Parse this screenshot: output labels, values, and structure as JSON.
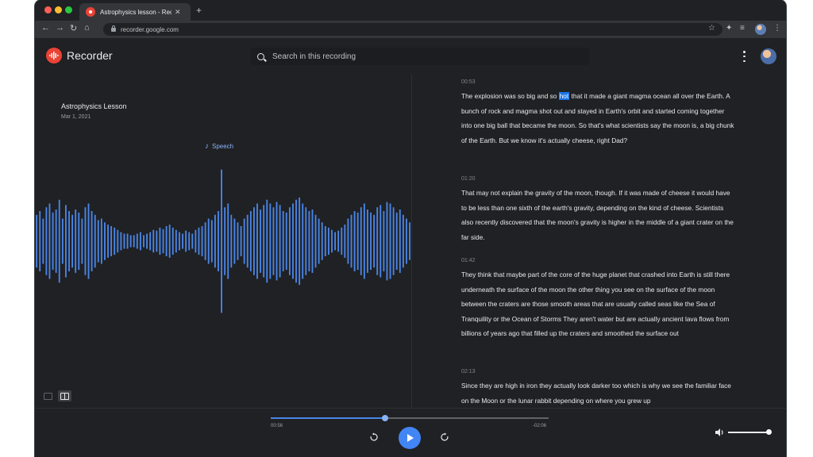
{
  "browser": {
    "tab_title": "Astrophysics lesson - Recorder",
    "new_tab": "+",
    "url": "recorder.google.com"
  },
  "app": {
    "title": "Recorder",
    "search_placeholder": "Search in this recording"
  },
  "recording": {
    "title": "Astrophysics Lesson",
    "date": "Mar 1, 2021",
    "label": "Speech"
  },
  "transcript": [
    {
      "time": "00:53",
      "pre": "The explosion was so big and so ",
      "highlight": "hot",
      "post": " that it made a giant magma ocean all over the Earth. A bunch of rock and magma shot out and stayed in Earth's orbit and started coming together into one big ball that became the moon. So that's what scientists say the moon is, a big chunk of the Earth. But we know it's actually cheese, right Dad?"
    },
    {
      "time": "01:20",
      "pre": "That may not explain the gravity of the moon, though. If it was made of cheese it would have to be less than one sixth of the earth's gravity, depending on the kind of cheese. Scientists also recently discovered that the moon's gravity is higher in the middle of a giant crater on the far side.",
      "highlight": "",
      "post": ""
    },
    {
      "time": "01:42",
      "pre": "They think that maybe part of the core of the huge planet that crashed into Earth is still there underneath the surface of the moon the other thing you see on the surface of the moon between the craters are those smooth areas that are usually called seas like the Sea of Tranquility or the Ocean of Storms They aren't water but are actually ancient lava flows from billions of years ago that filled up the craters and smoothed the surface out",
      "highlight": "",
      "post": ""
    },
    {
      "time": "02:13",
      "pre": "Since they are high in iron they actually look darker too which is why we see the familiar face on the Moon or the lunar rabbit depending on where you grew up",
      "highlight": "",
      "post": ""
    }
  ],
  "player": {
    "elapsed": "00:56",
    "remaining": "-02:06",
    "progress": 0.41,
    "volume": 0.92
  },
  "waveform": {
    "color": "#4a86e8",
    "amplitudes": [
      0.35,
      0.4,
      0.3,
      0.45,
      0.5,
      0.38,
      0.42,
      0.55,
      0.3,
      0.48,
      0.4,
      0.35,
      0.42,
      0.38,
      0.3,
      0.45,
      0.5,
      0.4,
      0.35,
      0.28,
      0.3,
      0.25,
      0.22,
      0.2,
      0.18,
      0.15,
      0.12,
      0.1,
      0.1,
      0.08,
      0.08,
      0.1,
      0.12,
      0.08,
      0.1,
      0.12,
      0.15,
      0.14,
      0.18,
      0.16,
      0.2,
      0.22,
      0.18,
      0.15,
      0.12,
      0.1,
      0.14,
      0.12,
      0.1,
      0.15,
      0.18,
      0.2,
      0.25,
      0.3,
      0.28,
      0.35,
      0.4,
      0.95,
      0.45,
      0.5,
      0.35,
      0.3,
      0.25,
      0.2,
      0.3,
      0.35,
      0.4,
      0.45,
      0.5,
      0.42,
      0.48,
      0.55,
      0.5,
      0.45,
      0.52,
      0.48,
      0.4,
      0.38,
      0.45,
      0.5,
      0.55,
      0.58,
      0.5,
      0.45,
      0.4,
      0.42,
      0.35,
      0.3,
      0.25,
      0.2,
      0.18,
      0.15,
      0.12,
      0.14,
      0.18,
      0.22,
      0.3,
      0.35,
      0.4,
      0.38,
      0.45,
      0.5,
      0.42,
      0.38,
      0.35,
      0.45,
      0.48,
      0.4,
      0.52,
      0.5,
      0.45,
      0.38,
      0.42,
      0.35,
      0.3,
      0.25
    ]
  }
}
